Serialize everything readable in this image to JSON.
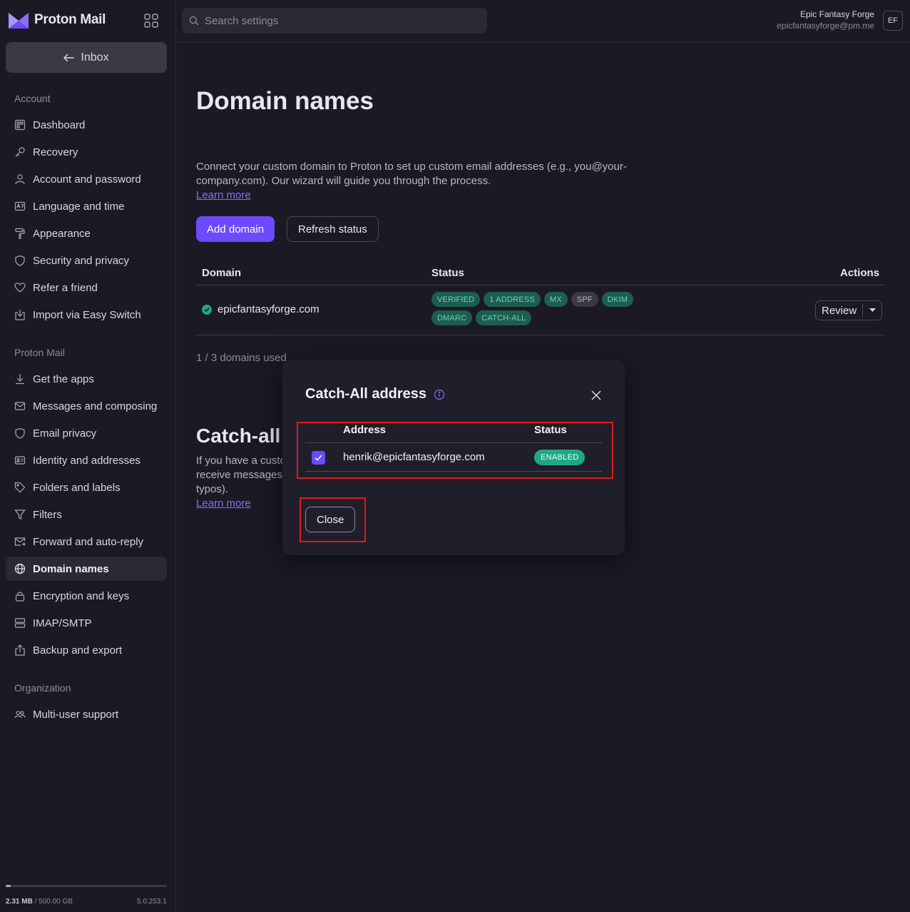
{
  "brand": {
    "name": "Proton Mail",
    "logo_icon": "proton-mail-logo",
    "apps_icon": "apps-grid-icon"
  },
  "sidebar": {
    "inbox_label": "Inbox",
    "sections": [
      {
        "title": "Account",
        "items": [
          {
            "label": "Dashboard",
            "icon": "dashboard-icon"
          },
          {
            "label": "Recovery",
            "icon": "key-icon"
          },
          {
            "label": "Account and password",
            "icon": "user-icon"
          },
          {
            "label": "Language and time",
            "icon": "language-icon"
          },
          {
            "label": "Appearance",
            "icon": "paint-roller-icon"
          },
          {
            "label": "Security and privacy",
            "icon": "shield-icon"
          },
          {
            "label": "Refer a friend",
            "icon": "heart-icon"
          },
          {
            "label": "Import via Easy Switch",
            "icon": "import-icon"
          }
        ]
      },
      {
        "title": "Proton Mail",
        "items": [
          {
            "label": "Get the apps",
            "icon": "download-icon"
          },
          {
            "label": "Messages and composing",
            "icon": "envelope-icon"
          },
          {
            "label": "Email privacy",
            "icon": "shield-icon"
          },
          {
            "label": "Identity and addresses",
            "icon": "id-card-icon"
          },
          {
            "label": "Folders and labels",
            "icon": "tag-icon"
          },
          {
            "label": "Filters",
            "icon": "filter-icon"
          },
          {
            "label": "Forward and auto-reply",
            "icon": "forward-icon"
          },
          {
            "label": "Domain names",
            "icon": "globe-icon",
            "active": true
          },
          {
            "label": "Encryption and keys",
            "icon": "lock-icon"
          },
          {
            "label": "IMAP/SMTP",
            "icon": "servers-icon"
          },
          {
            "label": "Backup and export",
            "icon": "export-icon"
          }
        ]
      },
      {
        "title": "Organization",
        "items": [
          {
            "label": "Multi-user support",
            "icon": "users-icon"
          }
        ]
      }
    ],
    "storage": {
      "used": "2.31 MB",
      "total": "/ 500.00 GB",
      "fraction": 4.6e-06
    },
    "version": "5.0.253.1"
  },
  "topbar": {
    "search_placeholder": "Search settings",
    "user_name": "Epic Fantasy Forge",
    "user_email": "epicfantasyforge@pm.me",
    "avatar_initials": "EF"
  },
  "main": {
    "title": "Domain names",
    "description": "Connect your custom domain to Proton to set up custom email addresses (e.g., you@your-company.com). Our wizard will guide you through the process.",
    "learn_more": "Learn more",
    "add_domain": "Add domain",
    "refresh_status": "Refresh status",
    "table": {
      "headers": {
        "domain": "Domain",
        "status": "Status",
        "actions": "Actions"
      },
      "rows": [
        {
          "domain": "epicfantasyforge.com",
          "badges": [
            {
              "label": "VERIFIED",
              "style": "green"
            },
            {
              "label": "1 ADDRESS",
              "style": "green"
            },
            {
              "label": "MX",
              "style": "green"
            },
            {
              "label": "SPF",
              "style": "grey"
            },
            {
              "label": "DKIM",
              "style": "green"
            },
            {
              "label": "DMARC",
              "style": "green"
            },
            {
              "label": "CATCH-ALL",
              "style": "green"
            }
          ],
          "action": "Review"
        }
      ]
    },
    "domains_used": "1 / 3 domains used",
    "catch_all_title": "Catch-all",
    "catch_all_desc_lines": [
      "If you have a custo",
      "receive messages",
      "typos)."
    ],
    "catch_all_learn_more": "Learn more"
  },
  "modal": {
    "title": "Catch-All address",
    "headers": {
      "address": "Address",
      "status": "Status"
    },
    "rows": [
      {
        "address": "henrik@epicfantasyforge.com",
        "status": "ENABLED",
        "checked": true
      }
    ],
    "close_label": "Close"
  },
  "colors": {
    "accent": "#6d4aff",
    "success": "#1ea885",
    "highlight": "#e01b1b",
    "background": "#1b1a24"
  }
}
